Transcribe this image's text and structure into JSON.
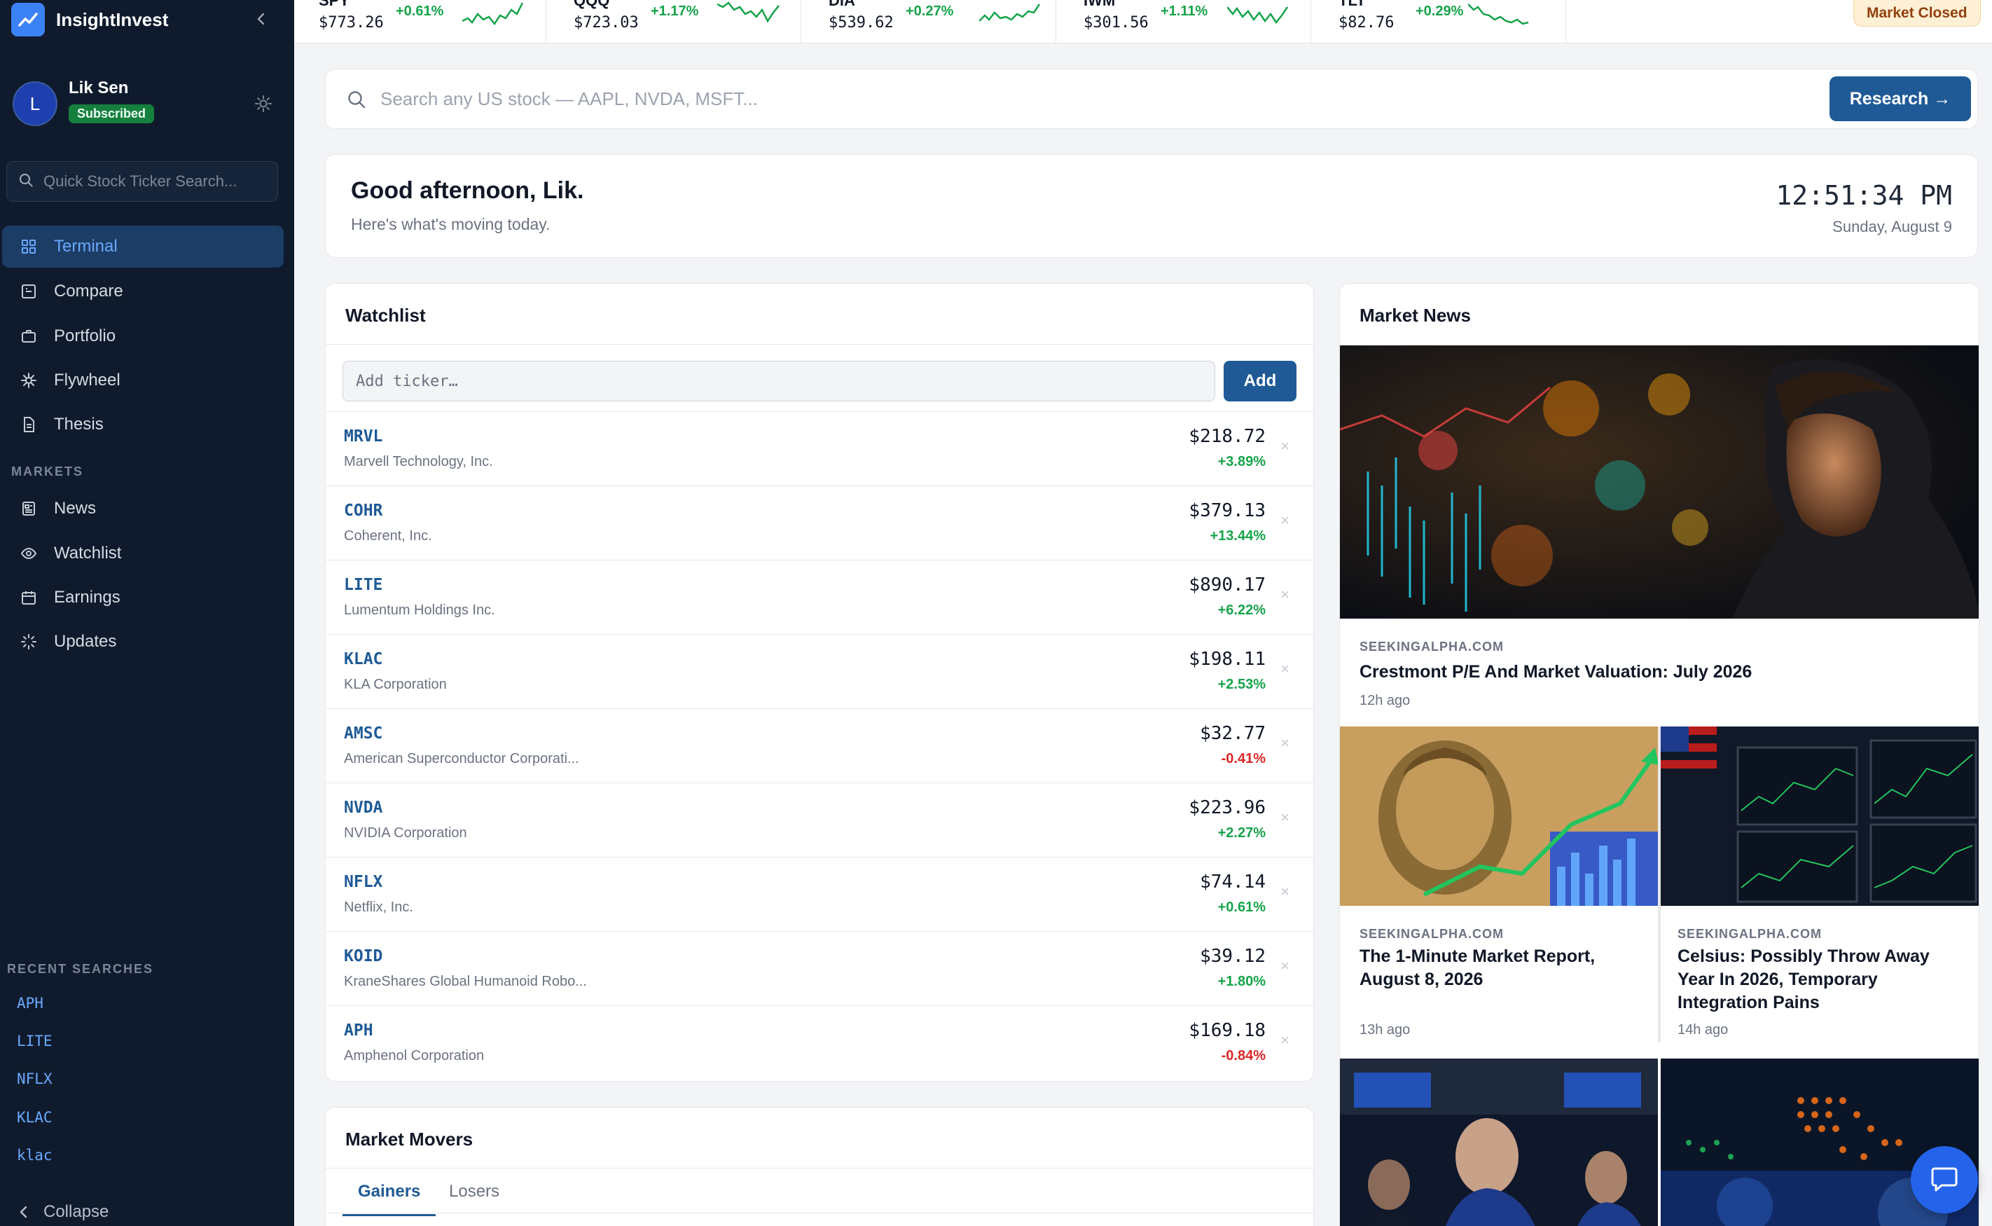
{
  "app": {
    "name": "InsightInvest"
  },
  "user": {
    "initial": "L",
    "name": "Lik Sen",
    "badge": "Subscribed"
  },
  "sidebar": {
    "search_placeholder": "Quick Stock Ticker Search...",
    "nav": [
      {
        "label": "Terminal",
        "icon": "grid-icon",
        "active": true
      },
      {
        "label": "Compare",
        "icon": "compare-icon"
      },
      {
        "label": "Portfolio",
        "icon": "briefcase-icon"
      },
      {
        "label": "Flywheel",
        "icon": "flywheel-icon"
      },
      {
        "label": "Thesis",
        "icon": "document-icon"
      }
    ],
    "markets_title": "MARKETS",
    "markets": [
      {
        "label": "News",
        "icon": "newspaper-icon"
      },
      {
        "label": "Watchlist",
        "icon": "eye-icon"
      },
      {
        "label": "Earnings",
        "icon": "calendar-icon"
      },
      {
        "label": "Updates",
        "icon": "loader-icon"
      }
    ],
    "recent_title": "RECENT SEARCHES",
    "recent": [
      "APH",
      "LITE",
      "NFLX",
      "KLAC",
      "klac"
    ],
    "collapse_label": "Collapse"
  },
  "tickers": [
    {
      "symbol": "SPY",
      "price": "$773.26",
      "change": "+0.61%"
    },
    {
      "symbol": "QQQ",
      "price": "$723.03",
      "change": "+1.17%"
    },
    {
      "symbol": "DIA",
      "price": "$539.62",
      "change": "+0.27%"
    },
    {
      "symbol": "IWM",
      "price": "$301.56",
      "change": "+1.11%"
    },
    {
      "symbol": "TLT",
      "price": "$82.76",
      "change": "+0.29%"
    }
  ],
  "market_status": "Market Closed",
  "colors": {
    "accent": "#1f5a96",
    "positive": "#16a34a",
    "negative": "#dc2626",
    "sidebar": "#0f1b2d"
  },
  "search": {
    "placeholder": "Search any US stock — AAPL, NVDA, MSFT...",
    "button": "Research →"
  },
  "greeting": {
    "title": "Good afternoon, Lik.",
    "subtitle": "Here's what's moving today.",
    "time": "12:51:34 PM",
    "date": "Sunday, August 9"
  },
  "watchlist": {
    "title": "Watchlist",
    "input_placeholder": "Add ticker…",
    "add_label": "Add",
    "remove_glyph": "×",
    "rows": [
      {
        "symbol": "MRVL",
        "name": "Marvell Technology, Inc.",
        "price": "$218.72",
        "change": "+3.89%",
        "dir": "pos"
      },
      {
        "symbol": "COHR",
        "name": "Coherent, Inc.",
        "price": "$379.13",
        "change": "+13.44%",
        "dir": "pos"
      },
      {
        "symbol": "LITE",
        "name": "Lumentum Holdings Inc.",
        "price": "$890.17",
        "change": "+6.22%",
        "dir": "pos"
      },
      {
        "symbol": "KLAC",
        "name": "KLA Corporation",
        "price": "$198.11",
        "change": "+2.53%",
        "dir": "pos"
      },
      {
        "symbol": "AMSC",
        "name": "American Superconductor Corporati...",
        "price": "$32.77",
        "change": "-0.41%",
        "dir": "neg"
      },
      {
        "symbol": "NVDA",
        "name": "NVIDIA Corporation",
        "price": "$223.96",
        "change": "+2.27%",
        "dir": "pos"
      },
      {
        "symbol": "NFLX",
        "name": "Netflix, Inc.",
        "price": "$74.14",
        "change": "+0.61%",
        "dir": "pos"
      },
      {
        "symbol": "KOID",
        "name": "KraneShares Global Humanoid Robo...",
        "price": "$39.12",
        "change": "+1.80%",
        "dir": "pos"
      },
      {
        "symbol": "APH",
        "name": "Amphenol Corporation",
        "price": "$169.18",
        "change": "-0.84%",
        "dir": "neg"
      }
    ]
  },
  "movers": {
    "title": "Market Movers",
    "tabs": [
      "Gainers",
      "Losers"
    ],
    "active_tab": "Gainers"
  },
  "news": {
    "title": "Market News",
    "items": [
      {
        "source": "SEEKINGALPHA.COM",
        "title": "Crestmont P/E And Market Valuation: July 2026",
        "time": "12h ago"
      },
      {
        "source": "SEEKINGALPHA.COM",
        "title": "The 1-Minute Market Report, August 8, 2026",
        "time": "13h ago"
      },
      {
        "source": "SEEKINGALPHA.COM",
        "title": "Celsius: Possibly Throw Away Year In 2026, Temporary Integration Pains",
        "time": "14h ago"
      }
    ]
  }
}
